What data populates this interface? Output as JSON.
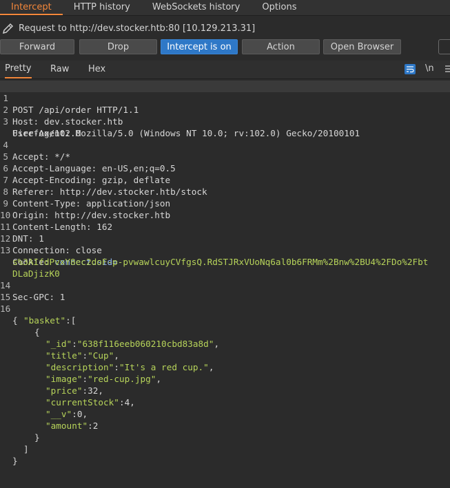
{
  "tabs": [
    "Intercept",
    "HTTP history",
    "WebSockets history",
    "Options"
  ],
  "request_line": "Request to http://dev.stocker.htb:80  [10.129.213.31]",
  "buttons": {
    "forward": "Forward",
    "drop": "Drop",
    "intercept": "Intercept is on",
    "action": "Action",
    "open_browser": "Open Browser"
  },
  "editor_tabs": [
    "Pretty",
    "Raw",
    "Hex"
  ],
  "toolbar": {
    "newline_label": "\\n"
  },
  "headers": {
    "l1": "POST /api/order HTTP/1.1",
    "l2": "Host: dev.stocker.htb",
    "l3a": "User-Agent: Mozilla/5.0 (Windows NT 10.0; rv:102.0) Gecko/20100101",
    "l3b": "Firefox/102.0",
    "l4": "Accept: */*",
    "l5": "Accept-Language: en-US,en;q=0.5",
    "l6": "Accept-Encoding: gzip, deflate",
    "l7": "Referer: http://dev.stocker.htb/stock",
    "l8": "Content-Type: application/json",
    "l9": "Origin: http://dev.stocker.htb",
    "l10": "Content-Length: 162",
    "l11": "DNT: 1",
    "l12": "Connection: close",
    "l13_name": "Cookie: ",
    "l13_cookie": "connect.sid=",
    "l13b": "s%3AIfdPvxY8ec2doF-p-pvwawlcuyCVfgsQ.RdSTJRxVUoNq6al0b6FRMm%2Bnw%2BU4%2FDo%2Fbt",
    "l13c": "DLaDjizK0",
    "l14": "Sec-GPC: 1"
  },
  "body": {
    "open": "{",
    "basket_key": "\"basket\"",
    "basket_rest": ":[",
    "obj_open": "{",
    "id_key": "\"_id\"",
    "id_val": "\"638f116eeb060210cbd83a8d\"",
    "title_key": "\"title\"",
    "title_val": "\"Cup\"",
    "desc_key": "\"description\"",
    "desc_val": "\"It's a red cup.\"",
    "image_key": "\"image\"",
    "image_val": "\"red-cup.jpg\"",
    "price_key": "\"price\"",
    "price_val": "32",
    "stock_key": "\"currentStock\"",
    "stock_val": "4",
    "v_key": "\"__v\"",
    "v_val": "0",
    "amount_key": "\"amount\"",
    "amount_val": "2",
    "obj_close": "}",
    "arr_close": "]",
    "close": "}"
  },
  "line_numbers": [
    "1",
    "2",
    "3",
    "4",
    "5",
    "6",
    "7",
    "8",
    "9",
    "10",
    "11",
    "12",
    "13",
    "14",
    "15",
    "16"
  ],
  "colors": {
    "accent": "#f4873a",
    "primary_button": "#2e78c7",
    "json_string": "#b7d45a"
  },
  "icons": [
    "pencil-icon",
    "word-wrap-icon",
    "menu-icon"
  ]
}
